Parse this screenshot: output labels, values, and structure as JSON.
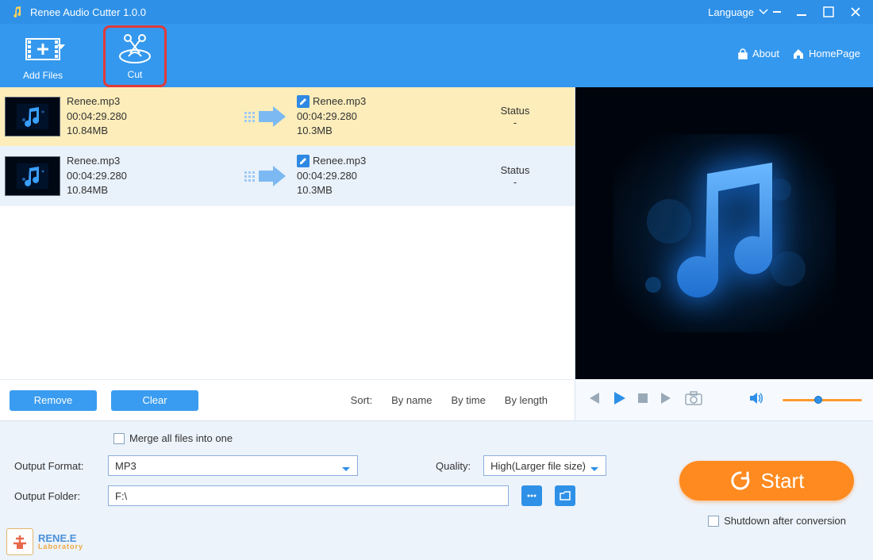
{
  "title": "Renee Audio Cutter 1.0.0",
  "language_label": "Language",
  "toolbar": {
    "add_files": "Add Files",
    "cut": "Cut"
  },
  "links": {
    "about": "About",
    "homepage": "HomePage"
  },
  "files": [
    {
      "src_name": "Renee.mp3",
      "src_duration": "00:04:29.280",
      "src_size": "10.84MB",
      "dst_name": "Renee.mp3",
      "dst_duration": "00:04:29.280",
      "dst_size": "10.3MB",
      "status_label": "Status",
      "status_value": "-"
    },
    {
      "src_name": "Renee.mp3",
      "src_duration": "00:04:29.280",
      "src_size": "10.84MB",
      "dst_name": "Renee.mp3",
      "dst_duration": "00:04:29.280",
      "dst_size": "10.3MB",
      "status_label": "Status",
      "status_value": "-"
    }
  ],
  "actions": {
    "remove": "Remove",
    "clear": "Clear"
  },
  "sort": {
    "label": "Sort:",
    "by_name": "By name",
    "by_time": "By time",
    "by_length": "By length"
  },
  "merge_label": "Merge all files into one",
  "output_format_label": "Output Format:",
  "output_format_value": "MP3",
  "quality_label": "Quality:",
  "quality_value": "High(Larger file size)",
  "output_folder_label": "Output Folder:",
  "output_folder_value": "F:\\",
  "start_label": "Start",
  "shutdown_label": "Shutdown after conversion",
  "brand": {
    "name": "RENE.E",
    "sub": "Laboratory"
  }
}
